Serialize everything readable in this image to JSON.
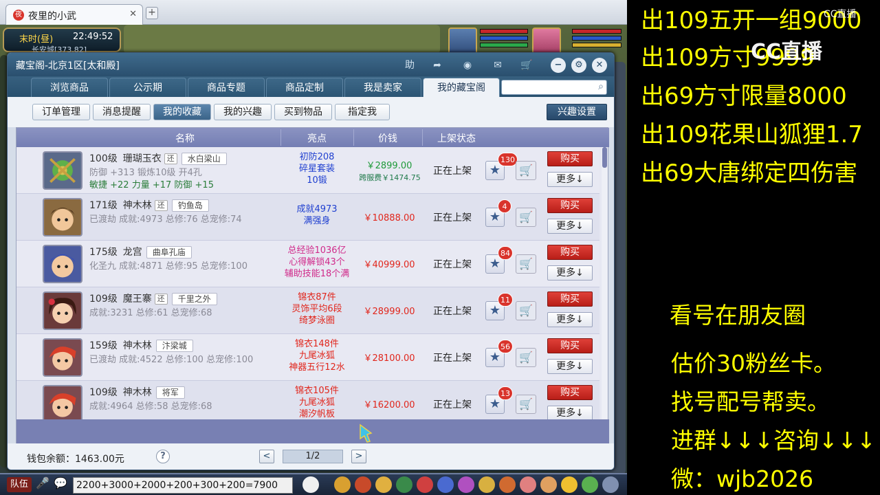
{
  "browser": {
    "tab_title": "夜里的小武",
    "tab_close": "✕",
    "new_tab": "+"
  },
  "game": {
    "clock_time": "末时(昼)",
    "clock_hm": "22:49:52",
    "location": "长安城[373,82]"
  },
  "dialog": {
    "title": "藏宝阁-北京1区[太和殿]",
    "toolbar_icons": [
      "help-icon",
      "share-icon",
      "record-icon",
      "chat-icon",
      "cart-icon"
    ],
    "help_label": "助",
    "nav_tabs": [
      "浏览商品",
      "公示期",
      "商品专题",
      "商品定制",
      "我是卖家",
      "我的藏宝阁"
    ],
    "active_nav": 5,
    "search_placeholder": "",
    "sub_tabs": [
      "订单管理",
      "消息提醒",
      "我的收藏",
      "我的兴趣",
      "买到物品",
      "指定我"
    ],
    "active_sub": 2,
    "interest_settings": "兴趣设置",
    "columns": [
      "名称",
      "亮点",
      "价钱",
      "上架状态"
    ],
    "rows": [
      {
        "level": "100级",
        "school": "珊瑚玉衣",
        "badge": "还",
        "server": "水白梁山",
        "line2": "防御 +313 锻炼10级 开4孔",
        "line3": "敏捷 +22 力量 +17 防御 +15",
        "highlights": [
          "初防208",
          "碎星套装",
          "10锻"
        ],
        "hl_color": "#2040d0",
        "price": "￥2899.00",
        "price_green": true,
        "cross_fee": "跨服费￥1474.75",
        "status": "正在上架",
        "fav_count": "130",
        "buy": "购买",
        "more": "更多↓",
        "avatar": "item"
      },
      {
        "level": "171级",
        "school": "神木林",
        "badge": "还",
        "server": "钓鱼岛",
        "line2": "已渡劫 成就:4973 总修:76 总宠修:74",
        "line3": "",
        "highlights": [
          "成就4973",
          "满强身"
        ],
        "hl_color": "#2040d0",
        "price": "￥10888.00",
        "price_green": false,
        "cross_fee": "",
        "status": "正在上架",
        "fav_count": "4",
        "buy": "购买",
        "more": "更多↓",
        "avatar": "boy"
      },
      {
        "level": "175级",
        "school": "龙宫",
        "badge": "",
        "server": "曲阜孔庙",
        "line2": "化圣九 成就:4871 总修:95 总宠修:100",
        "line3": "",
        "highlights": [
          "总经验1036亿",
          "心得解锁43个",
          "辅助技能18个满"
        ],
        "hl_color": "#d02a8a",
        "price": "￥40999.00",
        "price_green": false,
        "cross_fee": "",
        "status": "正在上架",
        "fav_count": "84",
        "buy": "购买",
        "more": "更多↓",
        "avatar": "blue"
      },
      {
        "level": "109级",
        "school": "魔王寨",
        "badge": "还",
        "server": "千里之外",
        "line2": "成就:3231 总修:61 总宠修:68",
        "line3": "",
        "highlights": [
          "锦衣87件",
          "灵饰平均6段",
          "绮梦泳圈"
        ],
        "hl_color": "#e1261c",
        "price": "￥28999.00",
        "price_green": false,
        "cross_fee": "",
        "status": "正在上架",
        "fav_count": "11",
        "buy": "购买",
        "more": "更多↓",
        "avatar": "girl"
      },
      {
        "level": "159级",
        "school": "神木林",
        "badge": "",
        "server": "汴梁城",
        "line2": "已渡劫 成就:4522 总修:100 总宠修:100",
        "line3": "",
        "highlights": [
          "锦衣148件",
          "九尾冰狐",
          "神器五行12水"
        ],
        "hl_color": "#e1261c",
        "price": "￥28100.00",
        "price_green": false,
        "cross_fee": "",
        "status": "正在上架",
        "fav_count": "56",
        "buy": "购买",
        "more": "更多↓",
        "avatar": "red"
      },
      {
        "level": "109级",
        "school": "神木林",
        "badge": "",
        "server": "将军",
        "line2": "成就:4964 总修:58 总宠修:68",
        "line3": "",
        "highlights": [
          "锦衣105件",
          "九尾冰狐",
          "潮汐帆板"
        ],
        "hl_color": "#e1261c",
        "price": "￥16200.00",
        "price_green": false,
        "cross_fee": "",
        "status": "正在上架",
        "fav_count": "13",
        "buy": "购买",
        "more": "更多↓",
        "avatar": "red"
      }
    ],
    "wallet": "钱包余额：1463.00元",
    "help": "?",
    "prev": "<",
    "page": "1/2",
    "next": ">"
  },
  "bottom": {
    "team": "队伍",
    "chat_input": "2200+3000+2000+200+300+200=7900"
  },
  "stream": {
    "cc_logo": "CC直播",
    "cc_small": "CC直播",
    "sales": [
      "出109五开一组9000",
      "出109方寸9999",
      "出69方寸限量8000",
      "出109花果山狐狸1.7",
      "出69大唐绑定四伤害"
    ],
    "info": [
      "看号在朋友圈",
      "估价30粉丝卡。",
      "找号配号帮卖。",
      "进群↓↓↓咨询↓↓↓",
      "微：wjb2026"
    ]
  }
}
